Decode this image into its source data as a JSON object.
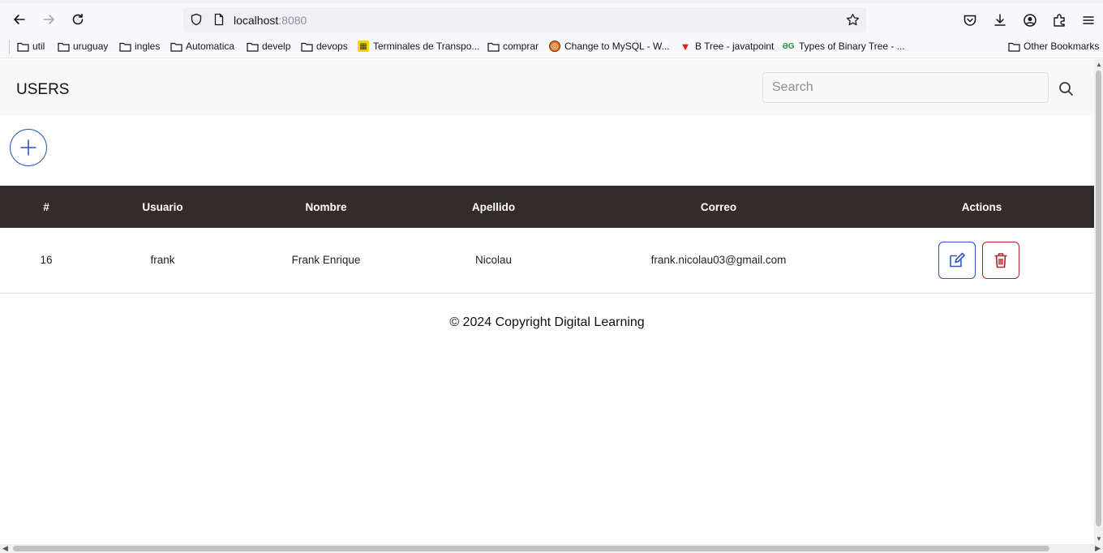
{
  "browser": {
    "url_host": "localhost",
    "url_port": ":8080",
    "bookmarks": [
      {
        "label": "util",
        "icon": "folder-icon"
      },
      {
        "label": "uruguay",
        "icon": "folder-icon"
      },
      {
        "label": "ingles",
        "icon": "folder-icon"
      },
      {
        "label": "Automatica",
        "icon": "folder-icon"
      },
      {
        "label": "develp",
        "icon": "folder-icon"
      },
      {
        "label": "devops",
        "icon": "folder-icon"
      },
      {
        "label": "Terminales de Transpo...",
        "icon": "favicon"
      },
      {
        "label": "comprar",
        "icon": "folder-icon"
      },
      {
        "label": "Change to MySQL - W...",
        "icon": "favicon"
      },
      {
        "label": "B Tree - javatpoint",
        "icon": "favicon"
      },
      {
        "label": "Types of Binary Tree - ...",
        "icon": "favicon"
      }
    ],
    "other_bookmarks": "Other Bookmarks"
  },
  "header": {
    "title": "USERS",
    "search_placeholder": "Search"
  },
  "table": {
    "columns": [
      "#",
      "Usuario",
      "Nombre",
      "Apellido",
      "Correo",
      "Actions"
    ],
    "rows": [
      {
        "id": "16",
        "usuario": "frank",
        "nombre": "Frank Enrique",
        "apellido": "Nicolau",
        "correo": "frank.nicolau03@gmail.com"
      }
    ]
  },
  "footer": {
    "text": "© 2024 Copyright Digital Learning"
  },
  "colors": {
    "primary": "#2a57c4",
    "danger": "#b3202c",
    "table_header_bg": "#342c2b",
    "navbar_bg": "#f8f8f8"
  }
}
